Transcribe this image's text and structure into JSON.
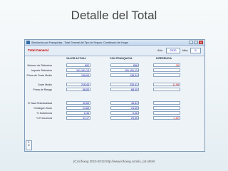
{
  "slide": {
    "title": "Detalle del Total",
    "footer": "(C) Infoxeg 2010-2013 http://www.infoxeg.com/is_cst.shtml"
  },
  "window": {
    "title": "Simulación por Franquicias - Total General del Tipo de Seguro: Combinado del Hogar",
    "tab_title": "Total General",
    "year_label": "Año",
    "year_value": "2010",
    "month_label": "Mes",
    "month_value": "5",
    "columns": [
      "VALOR ACTUAL",
      "CON FRANQUICIA",
      "DIFERENCIA"
    ],
    "rows": [
      {
        "label": "Número de Siniestros",
        "actual": "692",
        "franquicia": "656",
        "diferencia": "-36"
      },
      {
        "label": "Importe Siniestros",
        "actual": "151.151,13",
        "franquicia": "151.151,13",
        "diferencia": ""
      },
      {
        "label": "Prima de Coste Medio",
        "actual": "138,94",
        "franquicia": "138,94",
        "diferencia": ""
      },
      {
        "label": "Coste Medio",
        "actual": "218,43",
        "franquicia": "230,41",
        "diferencia": "11,98"
      },
      {
        "label": "Prima de Riesgo",
        "actual": "68,00",
        "franquicia": "68,00",
        "diferencia": ""
      },
      {
        "label": "% Tasa Siniestralidad",
        "actual": "45,84",
        "franquicia": "45,84",
        "diferencia": ""
      },
      {
        "label": "% Margen Bruto",
        "actual": "24,65",
        "franquicia": "24,65",
        "diferencia": ""
      },
      {
        "label": "% Suficiencia",
        "actual": "6,46",
        "franquicia": "6,46",
        "diferencia": ""
      },
      {
        "label": "% Frecuencia",
        "actual": "31,17",
        "franquicia": "29,55",
        "diferencia": "-1,62"
      }
    ],
    "nav": [
      "1",
      "2"
    ]
  }
}
